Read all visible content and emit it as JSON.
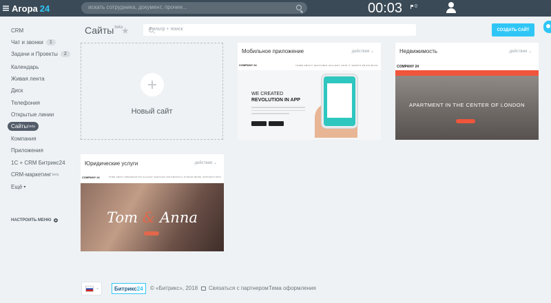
{
  "header": {
    "logo_name": "Агора",
    "logo_number": "24",
    "search_placeholder": "искать сотрудника, документ, прочее...",
    "timer": "00:03",
    "notifications": "0"
  },
  "sidebar": {
    "items": [
      {
        "label": "CRM"
      },
      {
        "label": "Чат и звонки",
        "count": "1"
      },
      {
        "label": "Задачи и Проекты",
        "count": "2"
      },
      {
        "label": "Календарь"
      },
      {
        "label": "Живая лента"
      },
      {
        "label": "Диск"
      },
      {
        "label": "Телефония"
      },
      {
        "label": "Открытые линии"
      },
      {
        "label": "Сайты",
        "badge": "beta"
      },
      {
        "label": "Компания"
      },
      {
        "label": "Приложения"
      },
      {
        "label": "1С + CRM Битрикс24"
      },
      {
        "label": "CRM-маркетинг",
        "badge": "beta"
      },
      {
        "label": "Ещё"
      }
    ],
    "configure_label": "НАСТРОИТЬ МЕНЮ"
  },
  "main": {
    "title": "Сайты",
    "title_badge": "beta",
    "filter_placeholder": "Фильтр + поиск",
    "create_button": "СОЗДАТЬ САЙТ",
    "new_site_label": "Новый сайт",
    "actions_label": "действия",
    "cards": [
      {
        "title": "Мобильное приложение",
        "preview": {
          "logo": "COMPANY 24",
          "menu": "HOME  ABOUT  FEATURES  GALLERY  HOW IT WORKS  PRICE  BLOG",
          "headline_1": "WE CREATED",
          "headline_2": "REVOLUTION IN APP"
        }
      },
      {
        "title": "Недвижимость",
        "preview": {
          "logo": "COMPANY 24",
          "headline": "APARTMENT IN THE CENTER OF LONDON"
        }
      },
      {
        "title": "Юридические услуги",
        "preview": {
          "logo": "COMPANY 24",
          "menu": "HOME  ABOUT  PRESENTATION  GALLERY  SERVICES  TESTIMONIALS  STORIES  BRIDE  INTRODUCTIONS",
          "name_1": "Tom",
          "amp": "&",
          "name_2": "Anna"
        }
      }
    ]
  },
  "footer": {
    "brand": "Битрикс",
    "brand_number": "24",
    "copyright": "© «Битрикс», 2018",
    "partner_link": "Связаться с партнером",
    "theme_link": "Тема оформления"
  },
  "colors": {
    "header_bg": "#3a4a56",
    "accent": "#2fc6f6",
    "active_nav": "#525c69",
    "realty_red": "#f0553b"
  }
}
